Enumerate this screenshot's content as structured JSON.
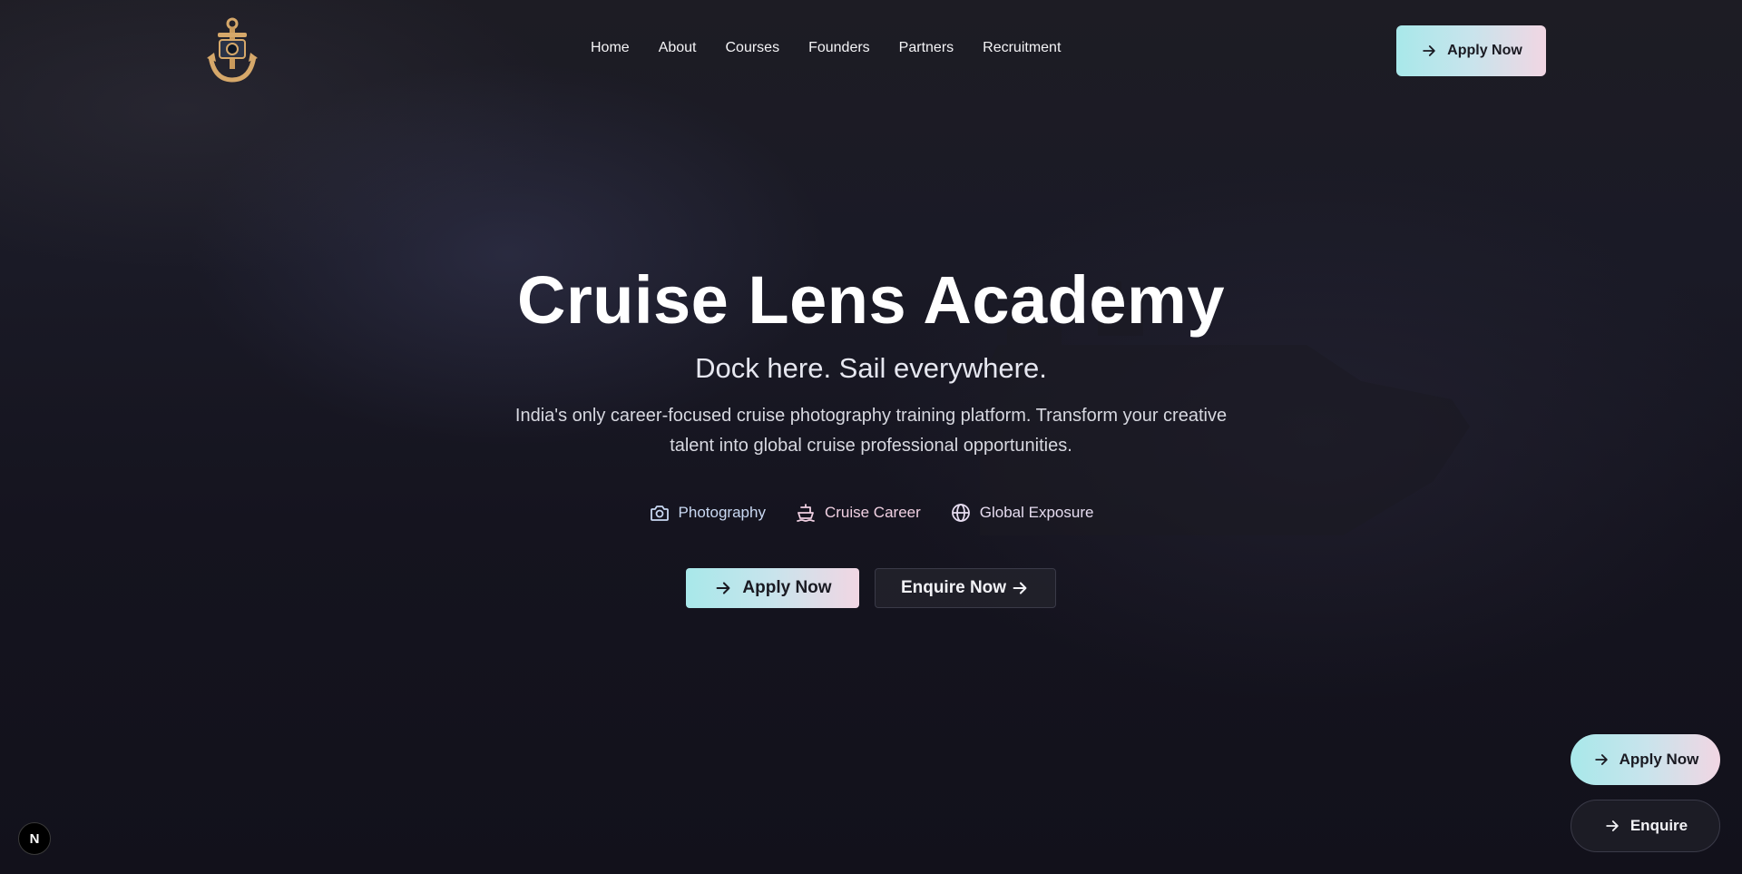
{
  "brand": {
    "logo_icon": "anchor-camera-logo",
    "accent_gradient": [
      "#a8e8ea",
      "#f1d6e3"
    ]
  },
  "nav": {
    "items": [
      {
        "label": "Home"
      },
      {
        "label": "About"
      },
      {
        "label": "Courses"
      },
      {
        "label": "Founders"
      },
      {
        "label": "Partners"
      },
      {
        "label": "Recruitment"
      }
    ],
    "apply_label": "Apply Now"
  },
  "hero": {
    "title": "Cruise Lens Academy",
    "tagline": "Dock here. Sail everywhere.",
    "description": "India's only career-focused cruise photography training platform. Transform your creative talent into global cruise professional opportunities.",
    "features": [
      {
        "icon": "camera-icon",
        "label": "Photography",
        "color": "#c9d8f2"
      },
      {
        "icon": "ship-icon",
        "label": "Cruise Career",
        "color": "#f0d0e2"
      },
      {
        "icon": "globe-icon",
        "label": "Global Exposure",
        "color": "#e6dcf0"
      }
    ],
    "apply_label": "Apply Now",
    "enquire_label": "Enquire Now"
  },
  "floating": {
    "apply_label": "Apply Now",
    "enquire_label": "Enquire"
  },
  "badge": {
    "label": "N"
  }
}
